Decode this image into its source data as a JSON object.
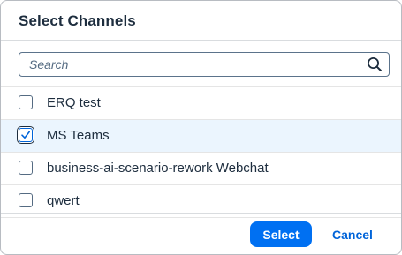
{
  "dialog": {
    "title": "Select Channels"
  },
  "search": {
    "placeholder": "Search",
    "value": "",
    "icon": "search-icon"
  },
  "channels": [
    {
      "label": "ERQ test",
      "checked": false
    },
    {
      "label": "MS Teams",
      "checked": true
    },
    {
      "label": "business-ai-scenario-rework Webchat",
      "checked": false
    },
    {
      "label": "qwert",
      "checked": false
    }
  ],
  "footer": {
    "select_label": "Select",
    "cancel_label": "Cancel"
  },
  "colors": {
    "accent": "#0070f2",
    "selected_row": "#ebf5fe",
    "text": "#1d2d3e",
    "link": "#0064d9"
  }
}
